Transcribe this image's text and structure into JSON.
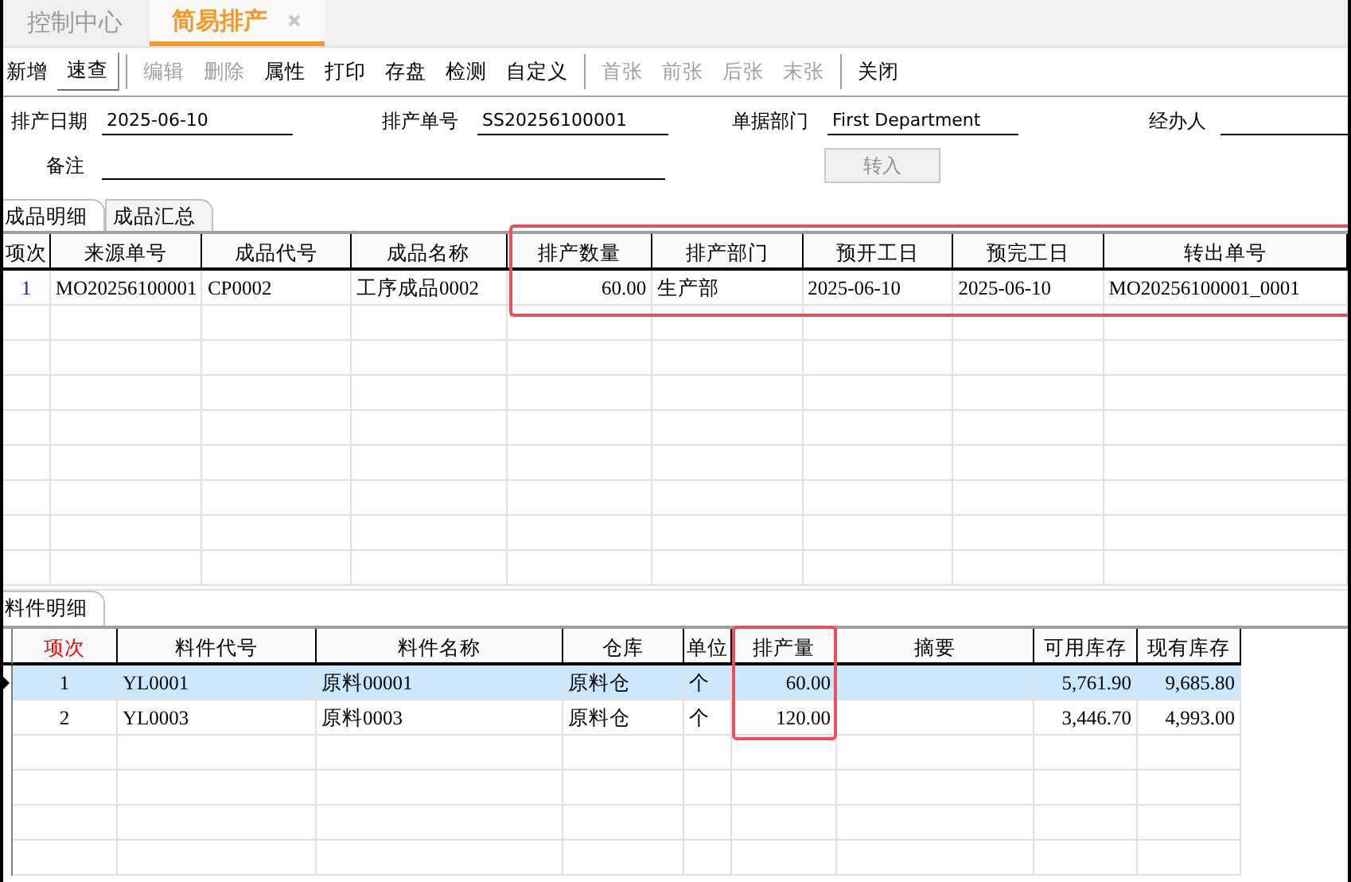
{
  "tabs": [
    {
      "label": "控制中心",
      "selected": false,
      "closable": false
    },
    {
      "label": "简易排产",
      "selected": true,
      "closable": true
    }
  ],
  "toolbar": [
    {
      "kind": "button",
      "label": "新增",
      "disabled": false,
      "pressed": false
    },
    {
      "kind": "button",
      "label": "速查",
      "disabled": false,
      "pressed": true
    },
    {
      "kind": "separator"
    },
    {
      "kind": "button",
      "label": "编辑",
      "disabled": true,
      "pressed": false
    },
    {
      "kind": "button",
      "label": "删除",
      "disabled": true,
      "pressed": false
    },
    {
      "kind": "button",
      "label": "属性",
      "disabled": false,
      "pressed": false
    },
    {
      "kind": "button",
      "label": "打印",
      "disabled": false,
      "pressed": false
    },
    {
      "kind": "button",
      "label": "存盘",
      "disabled": false,
      "pressed": false
    },
    {
      "kind": "button",
      "label": "检测",
      "disabled": false,
      "pressed": false
    },
    {
      "kind": "button",
      "label": "自定义",
      "disabled": false,
      "pressed": false
    },
    {
      "kind": "separator"
    },
    {
      "kind": "button",
      "label": "首张",
      "disabled": true,
      "pressed": false
    },
    {
      "kind": "button",
      "label": "前张",
      "disabled": true,
      "pressed": false
    },
    {
      "kind": "button",
      "label": "后张",
      "disabled": true,
      "pressed": false
    },
    {
      "kind": "button",
      "label": "末张",
      "disabled": true,
      "pressed": false
    },
    {
      "kind": "separator"
    },
    {
      "kind": "button",
      "label": "关闭",
      "disabled": false,
      "pressed": false
    }
  ],
  "form": {
    "date": {
      "label": "排产日期",
      "value": "2025-06-10"
    },
    "number": {
      "label": "排产单号",
      "value": "SS20256100001"
    },
    "department": {
      "label": "单据部门",
      "value": "First Department"
    },
    "handler": {
      "label": "经办人"
    },
    "remark": {
      "label": "备注"
    },
    "transfer_button": {
      "label": "转入",
      "disabled": true
    }
  },
  "product_tabs": [
    {
      "label": "成品明细",
      "selected": true
    },
    {
      "label": "成品汇总",
      "selected": false
    }
  ],
  "products": {
    "columns": [
      {
        "label": "项次",
        "highlighted": false,
        "emphasized": false
      },
      {
        "label": "来源单号",
        "highlighted": false,
        "emphasized": false
      },
      {
        "label": "成品代号",
        "highlighted": false,
        "emphasized": false
      },
      {
        "label": "成品名称",
        "highlighted": false,
        "emphasized": false
      },
      {
        "label": "排产数量",
        "highlighted": true,
        "emphasized": false
      },
      {
        "label": "排产部门",
        "highlighted": true,
        "emphasized": false
      },
      {
        "label": "预开工日",
        "highlighted": true,
        "emphasized": false
      },
      {
        "label": "预完工日",
        "highlighted": true,
        "emphasized": false
      },
      {
        "label": "转出单号",
        "highlighted": true,
        "emphasized": false
      }
    ],
    "rows": [
      {
        "selected": false,
        "cells": [
          "1",
          "MO20256100001",
          "CP0002",
          "工序成品0002",
          "60.00",
          "生产部",
          "2025-06-10",
          "2025-06-10",
          "MO20256100001_0001"
        ]
      }
    ]
  },
  "material_tabs": [
    {
      "label": "料件明细",
      "selected": true
    }
  ],
  "materials": {
    "columns": [
      {
        "label": "项次",
        "highlighted": false,
        "emphasized": true
      },
      {
        "label": "料件代号",
        "highlighted": false,
        "emphasized": false
      },
      {
        "label": "料件名称",
        "highlighted": false,
        "emphasized": false
      },
      {
        "label": "仓库",
        "highlighted": false,
        "emphasized": false
      },
      {
        "label": "单位",
        "highlighted": false,
        "emphasized": false
      },
      {
        "label": "排产量",
        "highlighted": true,
        "emphasized": false
      },
      {
        "label": "摘要",
        "highlighted": false,
        "emphasized": false
      },
      {
        "label": "可用库存",
        "highlighted": false,
        "emphasized": false
      },
      {
        "label": "现有库存",
        "highlighted": false,
        "emphasized": false
      }
    ],
    "rows": [
      {
        "selected": true,
        "cells": [
          "1",
          "YL0001",
          "原料00001",
          "原料仓",
          "个",
          "60.00",
          "",
          "5,761.90",
          "9,685.80"
        ]
      },
      {
        "selected": false,
        "cells": [
          "2",
          "YL0003",
          "原料0003",
          "原料仓",
          "个",
          "120.00",
          "",
          "3,446.70",
          "4,993.00"
        ]
      }
    ]
  }
}
